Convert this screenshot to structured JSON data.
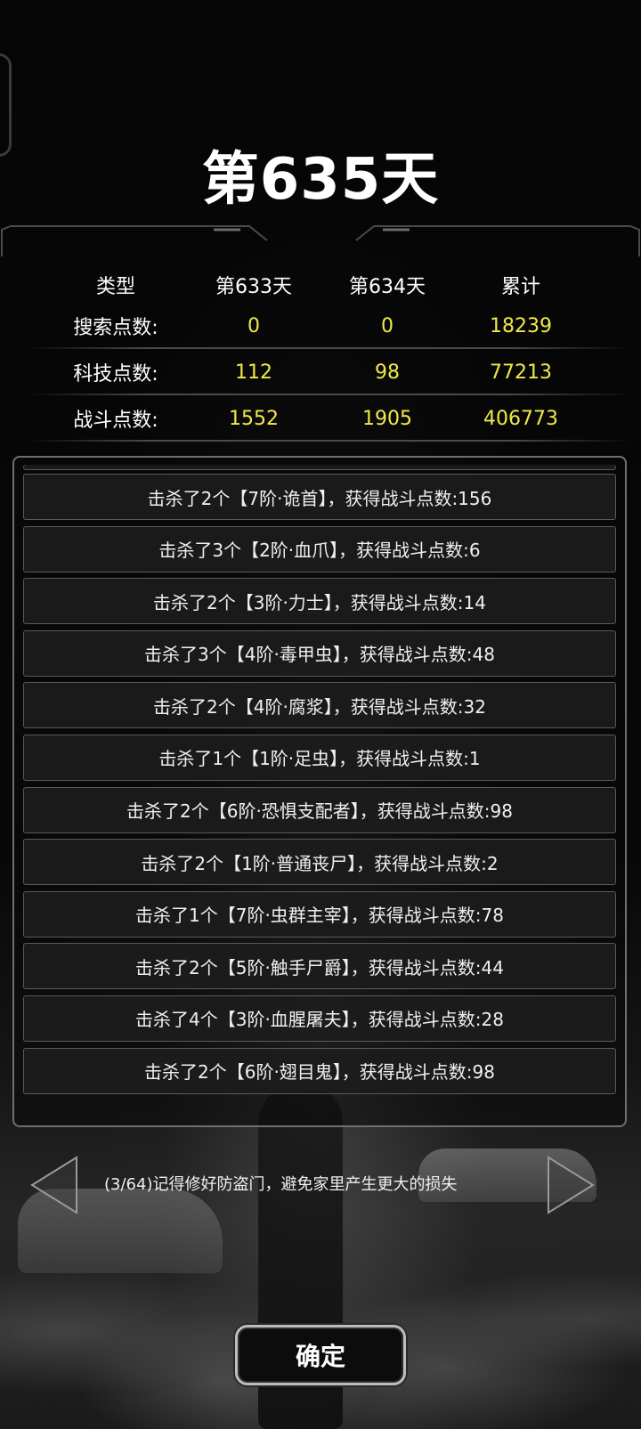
{
  "day_title": "第635天",
  "stats": {
    "headers": [
      "类型",
      "第633天",
      "第634天",
      "累计"
    ],
    "rows": [
      {
        "label": "搜索点数:",
        "day633": "0",
        "day634": "0",
        "total": "18239"
      },
      {
        "label": "科技点数:",
        "day633": "112",
        "day634": "98",
        "total": "77213"
      },
      {
        "label": "战斗点数:",
        "day633": "1552",
        "day634": "1905",
        "total": "406773"
      }
    ]
  },
  "kills": [
    "击杀了2个【7阶·诡首】，获得战斗点数:156",
    "击杀了3个【2阶·血爪】，获得战斗点数:6",
    "击杀了2个【3阶·力士】，获得战斗点数:14",
    "击杀了3个【4阶·毒甲虫】，获得战斗点数:48",
    "击杀了2个【4阶·腐浆】，获得战斗点数:32",
    "击杀了1个【1阶·足虫】，获得战斗点数:1",
    "击杀了2个【6阶·恐惧支配者】，获得战斗点数:98",
    "击杀了2个【1阶·普通丧尸】，获得战斗点数:2",
    "击杀了1个【7阶·虫群主宰】，获得战斗点数:78",
    "击杀了2个【5阶·触手尸爵】，获得战斗点数:44",
    "击杀了4个【3阶·血腥屠夫】，获得战斗点数:28",
    "击杀了2个【6阶·翅目鬼】，获得战斗点数:98"
  ],
  "tip": {
    "text": "(3/64)记得修好防盗门，避免家里产生更大的损失"
  },
  "confirm_label": "确定",
  "colors": {
    "accent_yellow": "#f1e84a",
    "text": "#ffffff",
    "panel_border": "#6f6f6f"
  },
  "icons": {
    "prev": "triangle-left-icon",
    "next": "triangle-right-icon"
  }
}
